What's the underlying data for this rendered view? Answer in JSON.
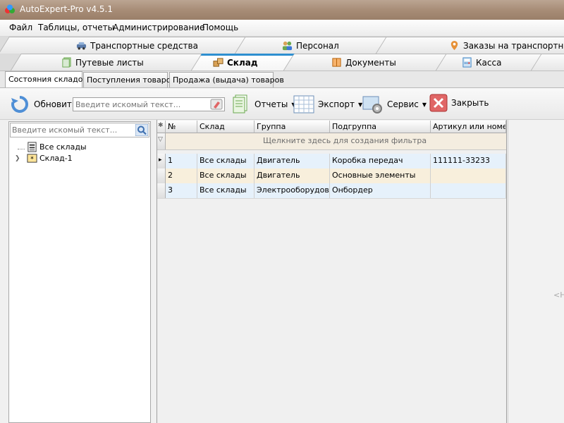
{
  "window": {
    "title": "AutoExpert-Pro v4.5.1"
  },
  "menu": [
    "Файл",
    "Таблицы, отчеты",
    "Администрирование",
    "Помощь"
  ],
  "tabs_row1": [
    {
      "label": "Транспортные средства",
      "icon": "car-icon"
    },
    {
      "label": "Персонал",
      "icon": "people-icon"
    },
    {
      "label": "Заказы на транспортные усл",
      "icon": "map-pin-icon"
    }
  ],
  "tabs_row2": [
    {
      "label": "Путевые листы",
      "icon": "document-green-icon"
    },
    {
      "label": "Склад",
      "icon": "boxes-icon",
      "active": true
    },
    {
      "label": "Документы",
      "icon": "book-icon"
    },
    {
      "label": "Касса",
      "icon": "calculator-icon"
    }
  ],
  "subtabs": [
    "Состояния складов",
    "Поступления товаров",
    "Продажа (выдача) товаров"
  ],
  "toolbar": {
    "refresh_label": "Обновить",
    "search_placeholder": "Введите искомый текст...",
    "reports_label": "Отчеты",
    "export_label": "Экспорт",
    "service_label": "Сервис",
    "close_label": "Закрыть"
  },
  "left": {
    "search_placeholder": "Введите искомый текст...",
    "tree": [
      "Все склады",
      "Склад-1"
    ]
  },
  "grid": {
    "columns": [
      "№",
      "Склад",
      "Группа",
      "Подгруппа",
      "Артикул или номер"
    ],
    "filter_hint": "Щелкните здесь для создания фильтра",
    "rows": [
      [
        "1",
        "Все склады",
        "Двигатель",
        "Коробка передач",
        "111111-33233"
      ],
      [
        "2",
        "Все склады",
        "Двигатель",
        "Основные элементы",
        ""
      ],
      [
        "3",
        "Все склады",
        "Электрооборудован",
        "Онбордер",
        ""
      ]
    ]
  },
  "right_hint": "<Н"
}
